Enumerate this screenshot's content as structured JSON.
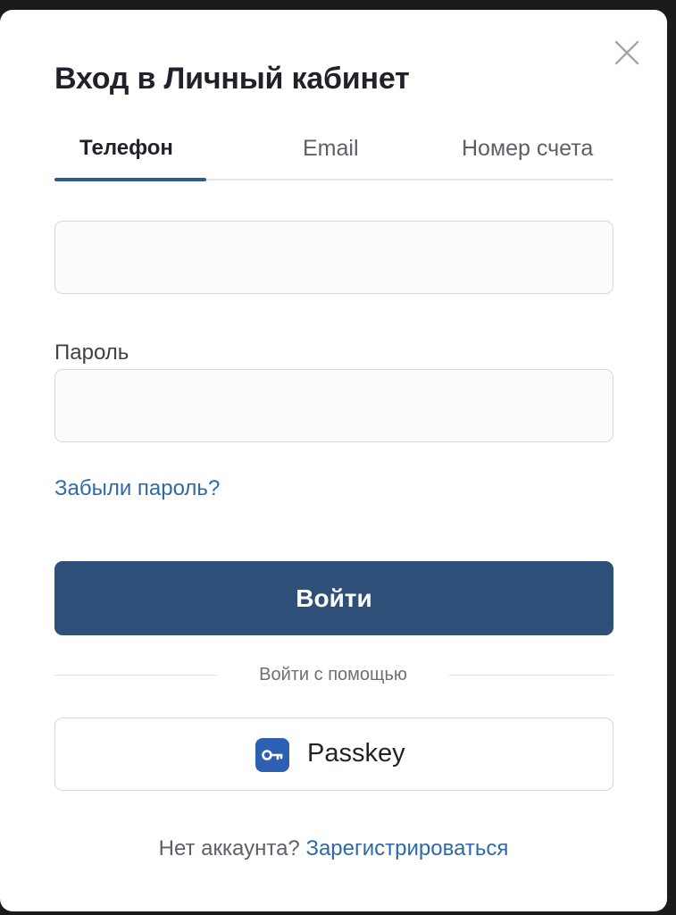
{
  "modal": {
    "title": "Вход в Личный кабинет",
    "close_icon": "close-icon"
  },
  "tabs": [
    {
      "label": "Телефон",
      "active": true
    },
    {
      "label": "Email",
      "active": false
    },
    {
      "label": "Номер счета",
      "active": false
    }
  ],
  "form": {
    "phone_value": "",
    "password_label": "Пароль",
    "password_value": "",
    "forgot_link": "Забыли пароль?",
    "submit_label": "Войти"
  },
  "alt_login": {
    "divider_text": "Войти с помощью",
    "passkey_label": "Passkey",
    "passkey_icon": "key-icon"
  },
  "footer": {
    "no_account_text": "Нет аккаунта?",
    "register_link": "Зарегистрироваться"
  },
  "colors": {
    "accent": "#2e5078",
    "link": "#2f6aa8",
    "tab_indicator": "#2f5a8f",
    "passkey_icon_bg": "#2d5fb3"
  }
}
